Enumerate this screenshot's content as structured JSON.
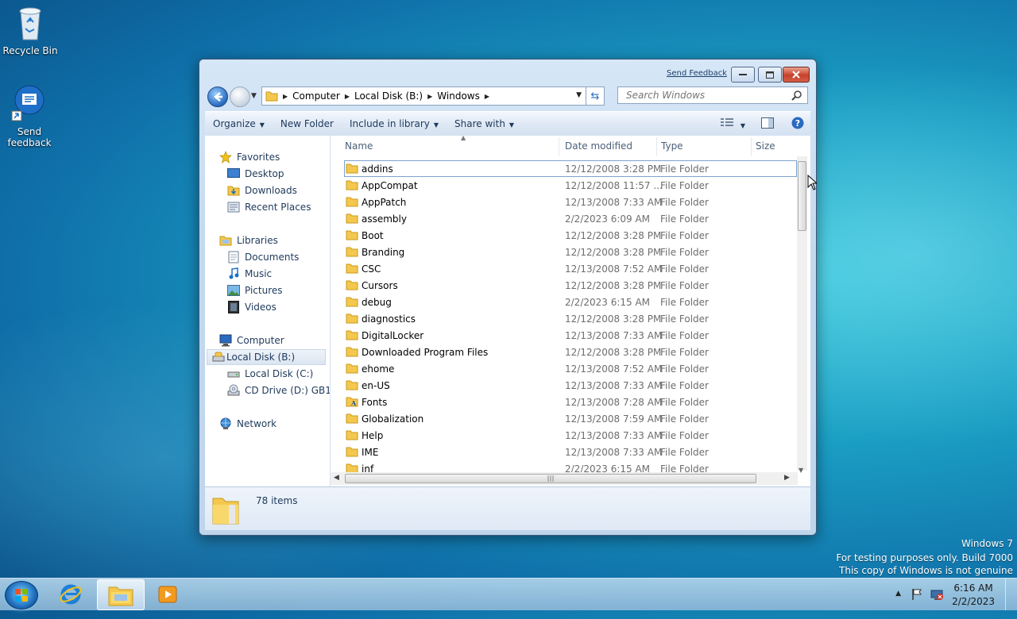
{
  "desktop": {
    "icons": [
      {
        "label": "Recycle Bin"
      },
      {
        "label": "Send feedback"
      }
    ],
    "watermark": [
      "Windows 7",
      "For testing purposes only. Build 7000",
      "This copy of Windows is not genuine"
    ]
  },
  "window": {
    "send_feedback": "Send Feedback",
    "address": [
      "Computer",
      "Local Disk (B:)",
      "Windows"
    ],
    "search_placeholder": "Search Windows",
    "toolbar": {
      "organize": "Organize",
      "new_folder": "New Folder",
      "include_in_library": "Include in library",
      "share_with": "Share with"
    },
    "nav": {
      "favorites": "Favorites",
      "desktop": "Desktop",
      "downloads": "Downloads",
      "recent_places": "Recent Places",
      "libraries": "Libraries",
      "documents": "Documents",
      "music": "Music",
      "pictures": "Pictures",
      "videos": "Videos",
      "computer": "Computer",
      "local_disk_b": "Local Disk (B:)",
      "local_disk_c": "Local Disk (C:)",
      "cd_drive": "CD Drive (D:) GB1CU",
      "network": "Network"
    },
    "columns": {
      "name": "Name",
      "date": "Date modified",
      "type": "Type",
      "size": "Size"
    },
    "files": [
      {
        "name": "addins",
        "date": "12/12/2008 3:28 PM",
        "type": "File Folder"
      },
      {
        "name": "AppCompat",
        "date": "12/12/2008 11:57 ...",
        "type": "File Folder"
      },
      {
        "name": "AppPatch",
        "date": "12/13/2008 7:33 AM",
        "type": "File Folder"
      },
      {
        "name": "assembly",
        "date": "2/2/2023 6:09 AM",
        "type": "File Folder"
      },
      {
        "name": "Boot",
        "date": "12/12/2008 3:28 PM",
        "type": "File Folder"
      },
      {
        "name": "Branding",
        "date": "12/12/2008 3:28 PM",
        "type": "File Folder"
      },
      {
        "name": "CSC",
        "date": "12/13/2008 7:52 AM",
        "type": "File Folder"
      },
      {
        "name": "Cursors",
        "date": "12/12/2008 3:28 PM",
        "type": "File Folder"
      },
      {
        "name": "debug",
        "date": "2/2/2023 6:15 AM",
        "type": "File Folder"
      },
      {
        "name": "diagnostics",
        "date": "12/12/2008 3:28 PM",
        "type": "File Folder"
      },
      {
        "name": "DigitalLocker",
        "date": "12/13/2008 7:33 AM",
        "type": "File Folder"
      },
      {
        "name": "Downloaded Program Files",
        "date": "12/12/2008 3:28 PM",
        "type": "File Folder"
      },
      {
        "name": "ehome",
        "date": "12/13/2008 7:52 AM",
        "type": "File Folder"
      },
      {
        "name": "en-US",
        "date": "12/13/2008 7:33 AM",
        "type": "File Folder"
      },
      {
        "name": "Fonts",
        "date": "12/13/2008 7:28 AM",
        "type": "File Folder"
      },
      {
        "name": "Globalization",
        "date": "12/13/2008 7:59 AM",
        "type": "File Folder"
      },
      {
        "name": "Help",
        "date": "12/13/2008 7:33 AM",
        "type": "File Folder"
      },
      {
        "name": "IME",
        "date": "12/13/2008 7:33 AM",
        "type": "File Folder"
      },
      {
        "name": "inf",
        "date": "2/2/2023 6:15 AM",
        "type": "File Folder"
      }
    ],
    "status": {
      "count": "78 items"
    }
  },
  "taskbar": {
    "time": "6:16 AM",
    "date": "2/2/2023"
  }
}
